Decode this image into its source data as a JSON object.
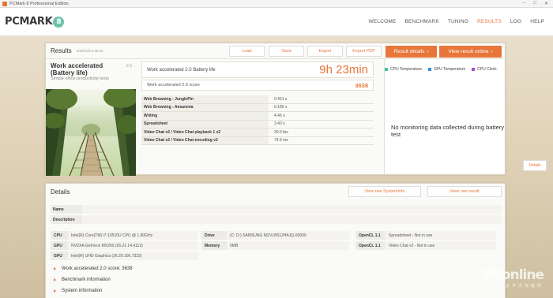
{
  "window": {
    "title": "PCMark 8 Professional Edition"
  },
  "header": {
    "logo_text": "PCMARK",
    "logo_version": "8",
    "nav": [
      {
        "label": "WELCOME"
      },
      {
        "label": "BENCHMARK"
      },
      {
        "label": "TUNING"
      },
      {
        "label": "RESULTS"
      },
      {
        "label": "LOG"
      },
      {
        "label": "HELP"
      }
    ],
    "active_nav": "RESULTS"
  },
  "results": {
    "title": "Results",
    "timestamp": "2020/1/3 0:15:32",
    "buttons": {
      "load": "Load",
      "save": "Save",
      "export": "Export",
      "export_pdf": "Export PDF"
    },
    "result_details": "Result details",
    "view_online": "View result online",
    "benchmark_name": "Work accelerated (Battery life)",
    "benchmark_version": "2.0",
    "benchmark_subtitle": "Simple office productivity tests",
    "main_label": "Work accelerated 2.0 Battery life",
    "main_value": "9h 23min",
    "score_label": "Work accelerated 2.0 score",
    "score_value": "3638",
    "tests": [
      {
        "name": "Web Browsing - JunglePin",
        "value": "0.461 s"
      },
      {
        "name": "Web Browsing - Amazonia",
        "value": "0.186 s"
      },
      {
        "name": "Writing",
        "value": "4.46 s"
      },
      {
        "name": "Spreadsheet",
        "value": "3.40 s"
      },
      {
        "name": "Video Chat v2 / Video Chat playback 1 v2",
        "value": "30.0 fps"
      },
      {
        "name": "Video Chat v2 / Video Chat encoding v2",
        "value": "74.9 ms"
      }
    ],
    "monitor": {
      "legend": [
        {
          "label": "CPU Temperature",
          "color": "#3cc6a8"
        },
        {
          "label": "GPU Temperature",
          "color": "#3d8fd6"
        },
        {
          "label": "CPU Clock",
          "color": "#a64fc8"
        }
      ],
      "message": "No monitoring data collected during battery test",
      "details_button": "Details"
    }
  },
  "details": {
    "title": "Details",
    "view_sysinfo": "View raw SystemInfo",
    "view_result": "View raw result",
    "name_label": "Name",
    "description_label": "Description",
    "system": [
      {
        "k": "CPU",
        "v": "Intel(R) Core(TM) i7-10510U CPU @ 1.80GHz"
      },
      {
        "k": "GPU",
        "v": "NVIDIA GeForce MX250 (26.21.14.4112)"
      },
      {
        "k": "GPU",
        "v": "Intel(R) UHD Graphics (26.20.100.7323)"
      }
    ],
    "drive": {
      "k": "Drive",
      "v": "(C: D:) SAMSUNG MZVLB512HAJQ-00000"
    },
    "memory": {
      "k": "Memory",
      "v": "0MB"
    },
    "opencl": [
      {
        "k": "OpenCL 1.1",
        "v": "Spreadsheet - Not in use"
      },
      {
        "k": "OpenCL 1.1",
        "v": "Video Chat v2 - Not in use"
      }
    ],
    "sections": [
      {
        "label": "Work accelerated 2.0 score: 3638"
      },
      {
        "label": "Benchmark information"
      },
      {
        "label": "System information"
      }
    ]
  },
  "watermark": {
    "text": "PConline",
    "sub": "太平洋电脑网"
  }
}
